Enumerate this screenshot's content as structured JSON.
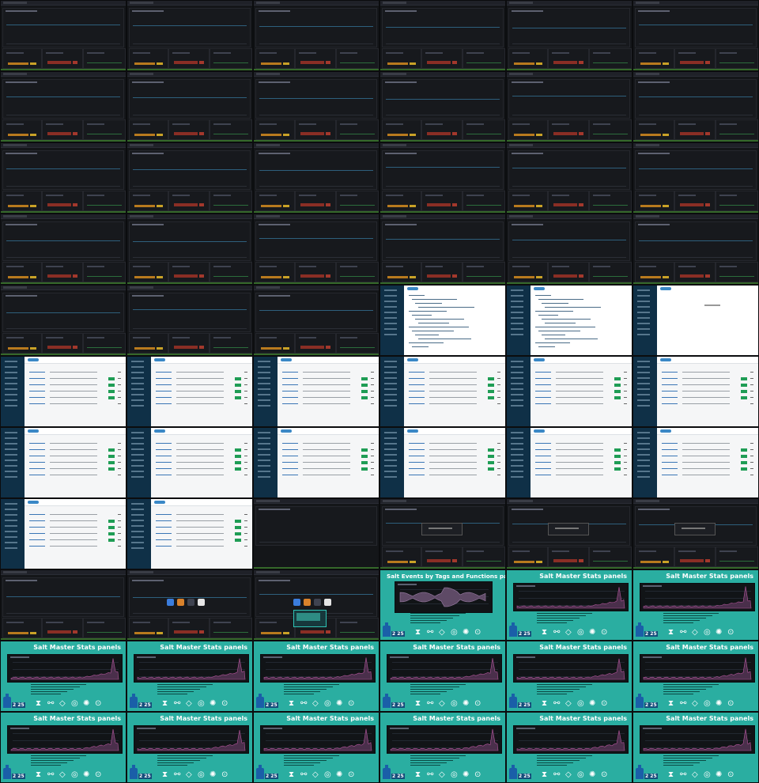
{
  "sheet": {
    "columns": 6,
    "rows": 11,
    "tiles": [
      {
        "kind": "dash"
      },
      {
        "kind": "dash"
      },
      {
        "kind": "dash"
      },
      {
        "kind": "dash"
      },
      {
        "kind": "dash"
      },
      {
        "kind": "dash"
      },
      {
        "kind": "dash"
      },
      {
        "kind": "dash"
      },
      {
        "kind": "dash"
      },
      {
        "kind": "dash"
      },
      {
        "kind": "dash"
      },
      {
        "kind": "dash"
      },
      {
        "kind": "dash"
      },
      {
        "kind": "dash"
      },
      {
        "kind": "dash"
      },
      {
        "kind": "dash"
      },
      {
        "kind": "dash"
      },
      {
        "kind": "dash"
      },
      {
        "kind": "dash"
      },
      {
        "kind": "dash"
      },
      {
        "kind": "dash"
      },
      {
        "kind": "dash"
      },
      {
        "kind": "dash"
      },
      {
        "kind": "dash"
      },
      {
        "kind": "dash"
      },
      {
        "kind": "dash"
      },
      {
        "kind": "dash"
      },
      {
        "kind": "light-code"
      },
      {
        "kind": "light-code"
      },
      {
        "kind": "light-blank"
      },
      {
        "kind": "light-table"
      },
      {
        "kind": "light-table"
      },
      {
        "kind": "light-table"
      },
      {
        "kind": "light-table"
      },
      {
        "kind": "light-table"
      },
      {
        "kind": "light-table"
      },
      {
        "kind": "light-table"
      },
      {
        "kind": "light-table"
      },
      {
        "kind": "light-table"
      },
      {
        "kind": "light-table"
      },
      {
        "kind": "light-table"
      },
      {
        "kind": "light-table"
      },
      {
        "kind": "light-table"
      },
      {
        "kind": "light-table"
      },
      {
        "kind": "dash-empty"
      },
      {
        "kind": "dash-modal"
      },
      {
        "kind": "dash-modal"
      },
      {
        "kind": "dash-modal"
      },
      {
        "kind": "dash"
      },
      {
        "kind": "dash-dock"
      },
      {
        "kind": "dash-dock-cyan"
      },
      {
        "kind": "slide-events"
      },
      {
        "kind": "slide-stats"
      },
      {
        "kind": "slide-stats"
      },
      {
        "kind": "slide-stats"
      },
      {
        "kind": "slide-stats"
      },
      {
        "kind": "slide-stats"
      },
      {
        "kind": "slide-stats"
      },
      {
        "kind": "slide-stats"
      },
      {
        "kind": "slide-stats"
      },
      {
        "kind": "slide-stats"
      },
      {
        "kind": "slide-stats"
      },
      {
        "kind": "slide-stats"
      },
      {
        "kind": "slide-stats"
      },
      {
        "kind": "slide-stats"
      },
      {
        "kind": "slide-stats"
      }
    ]
  },
  "slides": {
    "events_title": "Salt Events by Tags and Functions panel",
    "stats_title": "Salt Master Stats panels",
    "badge": "2 25"
  },
  "colors": {
    "teal": "#2aaea1",
    "dark_bg": "#141619",
    "light_bg": "#f5f6f7",
    "sidebar": "#0f3047",
    "status_ok": "#1f9d55"
  }
}
